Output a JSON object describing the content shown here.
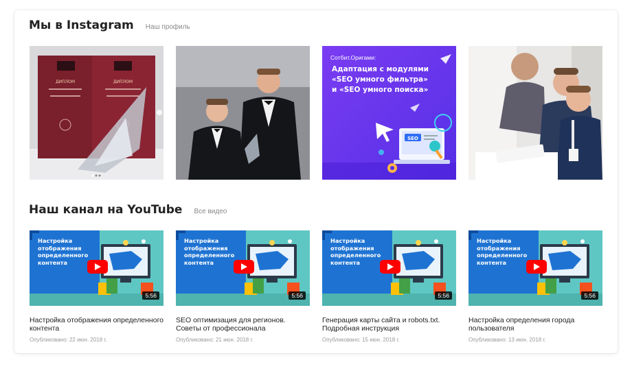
{
  "instagram": {
    "title": "Мы в Instagram",
    "link": "Наш профиль",
    "post3": {
      "brand": "Сотбит.Оригами:",
      "headline": [
        "Адаптация с модулями",
        "«SEO умного фильтра»",
        "и «SEO умного поиска»"
      ],
      "badge": "SEO"
    }
  },
  "youtube": {
    "title": "Наш канал на YouTube",
    "link": "Все видео",
    "videos": [
      {
        "thumb_title": "Настройка отображения определенного контента",
        "duration": "5:56",
        "title": "Настройка отображения определенного контента",
        "date": "Опубликовано: 22 июн. 2018 г."
      },
      {
        "thumb_title": "Настройка отображения определенного контента",
        "duration": "5:56",
        "title": "SEO оптимизация для регионов. Советы от профессионала",
        "date": "Опубликовано: 21 июн. 2018 г."
      },
      {
        "thumb_title": "Настройка отображения определенного контента",
        "duration": "5:56",
        "title": "Генерация карты сайта и robots.txt. Подробная инструкция",
        "date": "Опубликовано: 15 июн. 2018 г."
      },
      {
        "thumb_title": "Настройка отображения определенного контента",
        "duration": "5:56",
        "title": "Настройка определения города пользователя",
        "date": "Опубликовано: 13 июн. 2018 г."
      }
    ]
  },
  "colors": {
    "accent_purple": "#6a3df0",
    "youtube_red": "#ff0000",
    "thumb_teal": "#5fc7c3",
    "thumb_blue": "#1e73d2"
  }
}
